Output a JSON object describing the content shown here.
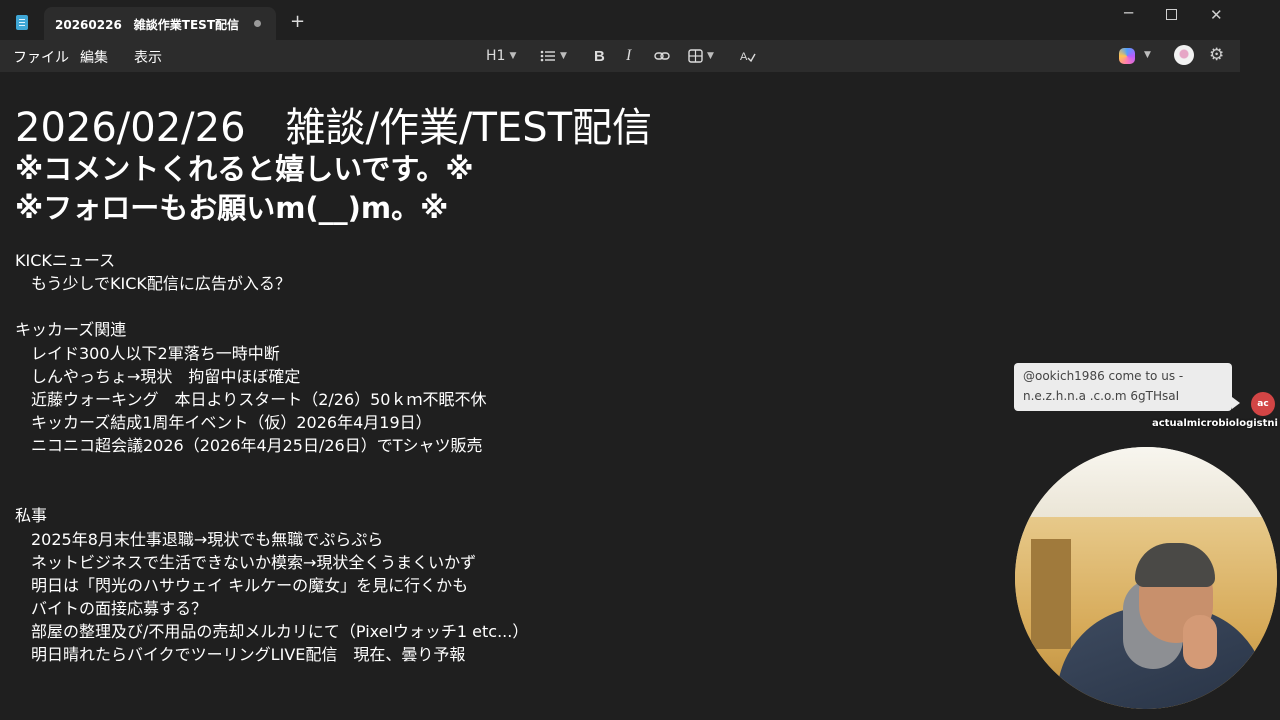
{
  "window": {
    "tab_title": "20260226　雑談作業TEST配信",
    "new_tab_glyph": "+",
    "minimize_glyph": "─",
    "close_glyph": "✕"
  },
  "menu": {
    "file": "ファイル",
    "edit": "編集",
    "view": "表示"
  },
  "toolbar": {
    "heading_label": "H1",
    "bold_glyph": "B",
    "italic_glyph": "I"
  },
  "document": {
    "title": "2026/02/26　雑談/作業/TEST配信",
    "subtitle1": "※コメントくれると嬉しいです。※",
    "subtitle2": "※フォローもお願いm(__)m。※",
    "lines": [
      "KICKニュース",
      "　もう少しでKICK配信に広告が入る？",
      "",
      "キッカーズ関連",
      "　レイド300人以下2軍落ち一時中断",
      "　しんやっちょ→現状　拘留中ほぼ確定",
      "　近藤ウォーキング　本日よりスタート（2/26）50ｋｍ不眠不休",
      "　キッカーズ結成1周年イベント（仮）2026年4月19日）",
      "　ニコニコ超会議2026（2026年4月25日/26日）でTシャツ販売",
      "",
      "",
      "私事",
      "　2025年8月末仕事退職→現状でも無職でぷらぷら",
      "　ネットビジネスで生活できないか模索→現状全くうまくいかず",
      "　明日は「閃光のハサウェイ キルケーの魔女」を見に行くかも",
      "　バイトの面接応募する？",
      "　部屋の整理及び/不用品の売却メルカリにて（Pixelウォッチ1 etc...）",
      "　明日晴れたらバイクでツーリングLIVE配信　現在、曇り予報"
    ]
  },
  "chat": {
    "message_line1": "@ookich1986 come to us -",
    "message_line2": "n.e.z.h.n.a .c.o.m 6gTHsaI",
    "avatar_initials": "ac",
    "username": "actualmicrobiologistni"
  },
  "colors": {
    "background": "#1f1f1f",
    "chrome": "#2c2c2c",
    "text": "#ffffff",
    "chat_avatar": "#d24545"
  },
  "icons": [
    "notepad-icon",
    "list-icon",
    "link-icon",
    "table-icon",
    "spellcheck-icon",
    "copilot-icon",
    "gear-icon"
  ]
}
